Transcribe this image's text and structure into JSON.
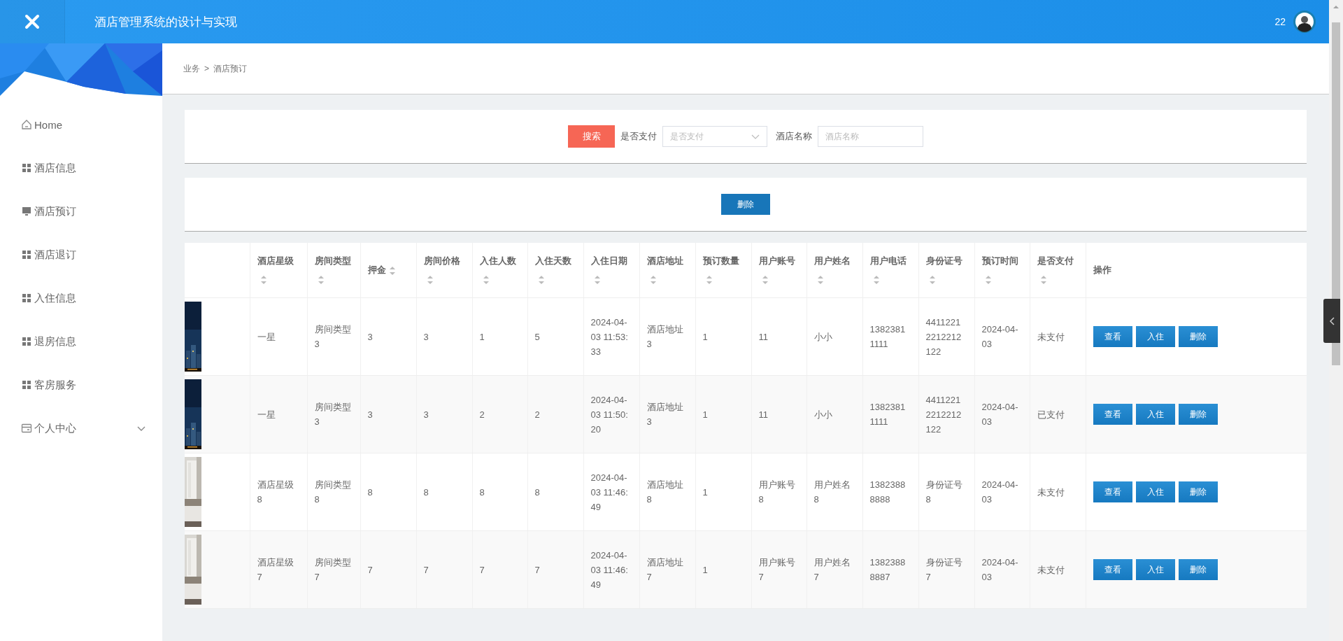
{
  "header": {
    "title": "酒店管理系统的设计与实现",
    "user_count": "22"
  },
  "sidebar": {
    "items": [
      {
        "label": "Home",
        "kind": "home"
      },
      {
        "label": "酒店信息",
        "kind": "module"
      },
      {
        "label": "酒店预订",
        "kind": "screen"
      },
      {
        "label": "酒店退订",
        "kind": "module"
      },
      {
        "label": "入住信息",
        "kind": "module"
      },
      {
        "label": "退房信息",
        "kind": "module"
      },
      {
        "label": "客房服务",
        "kind": "module"
      },
      {
        "label": "个人中心",
        "kind": "group",
        "expanded": false
      }
    ]
  },
  "breadcrumb": {
    "items": [
      "业务",
      "酒店预订"
    ],
    "separator": ">"
  },
  "search": {
    "button": "搜索",
    "fields": [
      {
        "label": "是否支付",
        "placeholder": "是否支付",
        "kind": "select"
      },
      {
        "label": "酒店名称",
        "placeholder": "酒店名称",
        "kind": "text"
      }
    ]
  },
  "actions": {
    "delete_button": "删除"
  },
  "table": {
    "columns": [
      {
        "label": "酒店星级",
        "sortable": true
      },
      {
        "label": "房间类型",
        "sortable": true
      },
      {
        "label": "押金",
        "sortable": true
      },
      {
        "label": "房间价格",
        "sortable": true
      },
      {
        "label": "入住人数",
        "sortable": true
      },
      {
        "label": "入住天数",
        "sortable": true
      },
      {
        "label": "入住日期",
        "sortable": true
      },
      {
        "label": "酒店地址",
        "sortable": true
      },
      {
        "label": "预订数量",
        "sortable": true
      },
      {
        "label": "用户账号",
        "sortable": true
      },
      {
        "label": "用户姓名",
        "sortable": true
      },
      {
        "label": "用户电话",
        "sortable": true
      },
      {
        "label": "身份证号",
        "sortable": true
      },
      {
        "label": "预订时间",
        "sortable": true
      },
      {
        "label": "是否支付",
        "sortable": true
      },
      {
        "label": "操作",
        "sortable": false
      }
    ],
    "rows": [
      {
        "thumbnail": {
          "kind": "picture"
        },
        "cells": [
          "一星",
          "房间类型3",
          "3",
          "3",
          "1",
          "5",
          "2024-04-03 11:53:33",
          "酒店地址3",
          "1",
          "11",
          "小小",
          "13823811111",
          "44112212212212122",
          "2024-04-03",
          "未支付"
        ],
        "buttons": [
          "查看",
          "入住",
          "删除"
        ]
      },
      {
        "thumbnail": {
          "kind": "picture"
        },
        "cells": [
          "一星",
          "房间类型3",
          "3",
          "3",
          "2",
          "2",
          "2024-04-03 11:50:20",
          "酒店地址3",
          "1",
          "11",
          "小小",
          "13823811111",
          "44112212212212122",
          "2024-04-03",
          "已支付"
        ],
        "buttons": [
          "查看",
          "入住",
          "删除"
        ]
      },
      {
        "thumbnail": {
          "kind": "picture"
        },
        "cells": [
          "酒店星级8",
          "房间类型8",
          "8",
          "8",
          "8",
          "8",
          "2024-04-03 11:46:49",
          "酒店地址8",
          "1",
          "用户账号8",
          "用户姓名8",
          "13823888888",
          "身份证号8",
          "2024-04-03",
          "未支付"
        ],
        "buttons": [
          "查看",
          "入住",
          "删除"
        ]
      },
      {
        "thumbnail": {
          "kind": "picture"
        },
        "cells": [
          "酒店星级7",
          "房间类型7",
          "7",
          "7",
          "7",
          "7",
          "2024-04-03 11:46:49",
          "酒店地址7",
          "1",
          "用户账号7",
          "用户姓名7",
          "13823888887",
          "身份证号7",
          "2024-04-03",
          "未支付"
        ],
        "buttons": [
          "查看",
          "入住",
          "删除"
        ]
      }
    ]
  }
}
